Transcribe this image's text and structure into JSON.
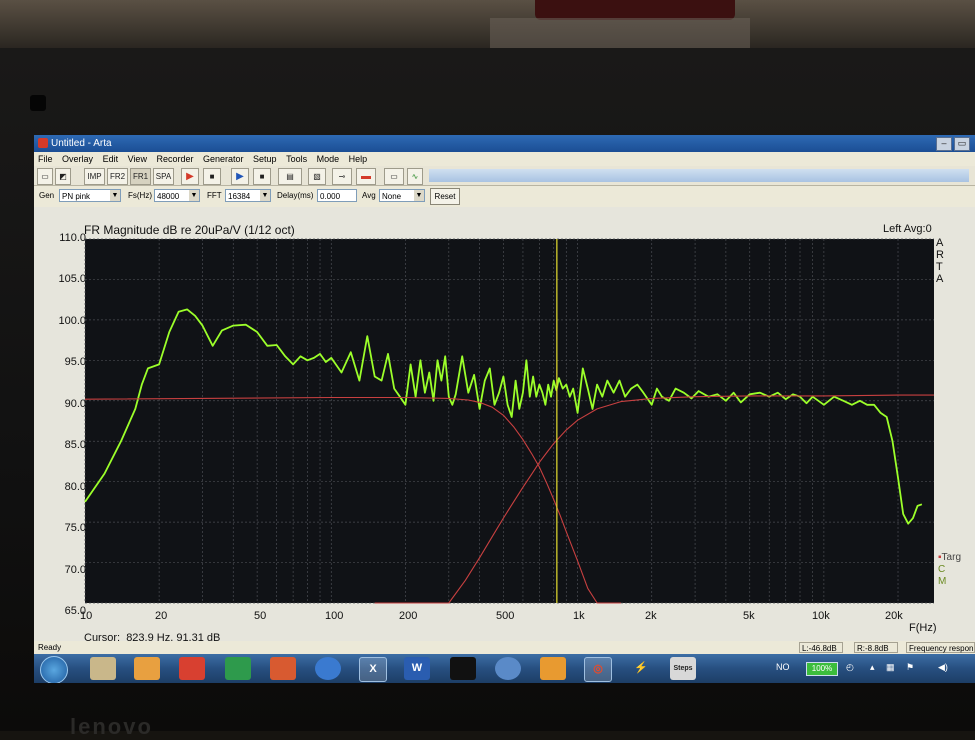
{
  "window": {
    "title": "Untitled - Arta",
    "min_glyph": "–",
    "max_glyph": "▭",
    "close_glyph": "✕"
  },
  "menu": [
    "File",
    "Overlay",
    "Edit",
    "View",
    "Recorder",
    "Generator",
    "Setup",
    "Tools",
    "Mode",
    "Help"
  ],
  "toolbar": {
    "imp": "IMP",
    "fr2": "FR2",
    "fr1": "FR1",
    "spa": "SPA"
  },
  "genbar": {
    "gen_label": "Gen",
    "gen_value": "PN pink",
    "fs_label": "Fs(Hz)",
    "fs_value": "48000",
    "fft_label": "FFT",
    "fft_value": "16384",
    "delay_label": "Delay(ms)",
    "delay_value": "0.000",
    "avg_label": "Avg",
    "avg_value": "None",
    "reset_label": "Reset"
  },
  "plot": {
    "title": "FR Magnitude dB re 20uPa/V (1/12 oct)",
    "channel": "Left  Avg:0",
    "side_letters": [
      "A",
      "R",
      "T",
      "A"
    ],
    "y_ticks": [
      "110.0",
      "105.0",
      "100.0",
      "95.0",
      "90.0",
      "85.0",
      "80.0",
      "75.0",
      "70.0",
      "65.0"
    ],
    "x_ticks": [
      "10",
      "20",
      "50",
      "100",
      "200",
      "500",
      "1k",
      "2k",
      "5k",
      "10k",
      "20k"
    ],
    "x_unit": "F(Hz)",
    "cursor_label": "Cursor:",
    "cursor_value": "823.9 Hz, 91.31 dB",
    "legend_targ": "Targ",
    "legend_c": "C",
    "legend_m": "M",
    "colors": {
      "background": "#101216",
      "grid": "#4a4c52",
      "response": "#9cff2a",
      "target": "#c84040",
      "cursor": "#e8e030"
    }
  },
  "chart_data": {
    "type": "line",
    "title": "FR Magnitude dB re 20uPa/V (1/12 oct)",
    "xlabel": "F(Hz)",
    "ylabel": "",
    "x_scale": "log",
    "xlim": [
      10,
      28000
    ],
    "ylim": [
      65,
      110
    ],
    "grid": true,
    "series": [
      {
        "name": "",
        "x": [
          10,
          12,
          14,
          16,
          17,
          18,
          20,
          22,
          24,
          26,
          28,
          30,
          33,
          36,
          40,
          45,
          50,
          55,
          60,
          65,
          70,
          75,
          80,
          85,
          90,
          95,
          100,
          110,
          120,
          130,
          140,
          150,
          160,
          170,
          180,
          190,
          200,
          210,
          220,
          230,
          240,
          250,
          260,
          270,
          280,
          290,
          300,
          310,
          320,
          340,
          360,
          380,
          400,
          420,
          440,
          460,
          480,
          500,
          520,
          540,
          560,
          580,
          600,
          620,
          640,
          660,
          680,
          700,
          720,
          740,
          760,
          780,
          800,
          820,
          840,
          870,
          900,
          930,
          960,
          1000,
          1050,
          1100,
          1150,
          1200,
          1260,
          1320,
          1400,
          1480,
          1560,
          1650,
          1750,
          1850,
          2000,
          2100,
          2200,
          2350,
          2500,
          2700,
          2900,
          3100,
          3400,
          3700,
          4000,
          4300,
          4600,
          5000,
          5500,
          6000,
          6500,
          7000,
          7500,
          8000,
          8500,
          9000,
          9500,
          10000,
          11000,
          12000,
          13000,
          14000,
          15000,
          16000,
          17000,
          18000,
          19000,
          20000,
          21000,
          22000,
          23000,
          24000,
          25000
        ],
        "values": [
          77.5,
          81,
          85,
          89,
          92,
          94,
          94.5,
          98.5,
          101,
          101.3,
          100.5,
          99.3,
          96.8,
          98.7,
          99.3,
          99.4,
          98.5,
          96.8,
          96.9,
          95.5,
          94.5,
          95.5,
          95,
          95.3,
          95.8,
          94.8,
          95.3,
          93.5,
          96,
          92.5,
          98,
          93,
          92.5,
          95.8,
          91.5,
          90.5,
          89.5,
          94.5,
          90.5,
          95,
          91,
          93.5,
          90,
          95,
          92.5,
          95.5,
          90.5,
          89.5,
          90.8,
          95.5,
          91,
          93.2,
          89,
          92.5,
          94,
          89.5,
          91,
          93,
          89.5,
          88,
          92.5,
          89,
          91,
          95,
          90.5,
          93,
          90.5,
          92,
          91,
          89.5,
          92,
          90.5,
          92.5,
          91.3,
          92.8,
          91.5,
          92,
          90.5,
          91.5,
          88.5,
          94,
          91.5,
          89,
          92,
          90.5,
          92.5,
          91,
          92.5,
          90.5,
          91.5,
          92,
          91,
          89.5,
          91.5,
          90.5,
          90,
          91.5,
          91,
          90.3,
          91.2,
          90.5,
          90.8,
          90,
          91,
          89.8,
          90.8,
          91,
          90.5,
          91,
          90.2,
          90.8,
          90.5,
          89.7,
          90.5,
          90,
          89.5,
          90.5,
          90,
          89.5,
          90,
          89.5,
          89.5,
          88.5,
          88,
          85,
          80.5,
          76,
          74.8,
          75.5,
          77,
          77.2
        ]
      },
      {
        "name": "Targ",
        "x": [
          10,
          100,
          200,
          300,
          360,
          400,
          450,
          500,
          550,
          600,
          650,
          700,
          750,
          800,
          850,
          900,
          1000,
          1100,
          1200,
          1300,
          1500
        ],
        "values": [
          90.2,
          90.4,
          90.4,
          90.3,
          90.1,
          89.8,
          89.2,
          88.2,
          86.8,
          85.2,
          83.5,
          81.8,
          79.8,
          77.8,
          75.8,
          73.8,
          70.2,
          66.8,
          63.5,
          60.5,
          55
        ]
      },
      {
        "name": "Targ",
        "x": [
          150,
          200,
          250,
          300,
          350,
          400,
          450,
          500,
          550,
          600,
          650,
          700,
          750,
          800,
          900,
          1000,
          1200,
          1500,
          2000,
          3000,
          5000,
          10000,
          20000,
          28000
        ],
        "values": [
          50,
          56,
          60.5,
          64.5,
          67.8,
          70.6,
          73.2,
          75.5,
          77.5,
          79.3,
          80.9,
          82.4,
          83.6,
          84.7,
          86.4,
          87.6,
          89,
          89.9,
          90.3,
          90.5,
          90.6,
          90.6,
          90.7,
          90.7
        ]
      }
    ]
  },
  "status": {
    "ready": "Ready",
    "left": "L:-46.8dB",
    "right": "R:-8.8dB",
    "freq": "Frequency respon"
  },
  "taskbar": {
    "apps": [
      "",
      "",
      "",
      "",
      "",
      "",
      "",
      "",
      "W",
      "",
      "",
      "",
      "",
      "",
      "Steps"
    ],
    "tray_no": "NO",
    "battery": "100%"
  }
}
